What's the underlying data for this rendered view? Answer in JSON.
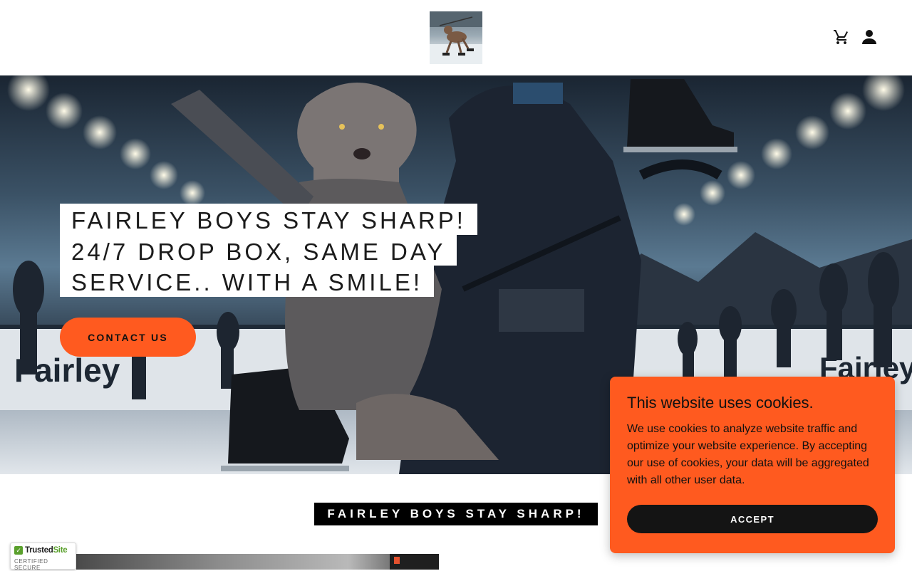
{
  "header": {
    "logo_icon": "dog-on-skates-logo",
    "cart_icon": "cart-icon",
    "account_icon": "user-icon"
  },
  "hero": {
    "headline_lines": [
      "FAIRLEY BOYS STAY SHARP!",
      "24/7 DROP BOX, SAME DAY",
      "SERVICE.. WITH A SMILE!"
    ],
    "cta_label": "CONTACT US",
    "boards_text_left": "Fairley",
    "boards_text_right": "Fairley"
  },
  "section": {
    "title": "FAIRLEY BOYS STAY SHARP!"
  },
  "trust_badge": {
    "brand_a": "Trusted",
    "brand_b": "Site",
    "tagline": "CERTIFIED SECURE"
  },
  "cookie_banner": {
    "title": "This website uses cookies.",
    "body": "We use cookies to analyze website traffic and optimize your website experience. By accepting our use of cookies, your data will be aggregated with all other user data.",
    "accept_label": "ACCEPT"
  },
  "colors": {
    "accent": "#ff5a1f",
    "dark_button": "#141414",
    "badge_green": "#5aa02c"
  }
}
